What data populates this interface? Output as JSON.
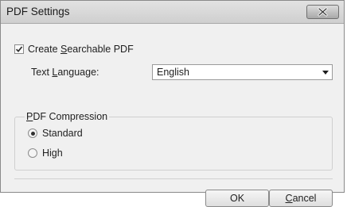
{
  "window": {
    "title": "PDF Settings"
  },
  "options": {
    "searchable": {
      "label_pre": "Create ",
      "label_ul": "S",
      "label_post": "earchable PDF",
      "checked": true
    },
    "language": {
      "label_pre": "Text ",
      "label_ul": "L",
      "label_post": "anguage:",
      "value": "English"
    }
  },
  "compression": {
    "group_ul": "P",
    "group_rest": "DF Compression",
    "options": [
      {
        "label": "Standard",
        "selected": true
      },
      {
        "label": "High",
        "selected": false
      }
    ]
  },
  "buttons": {
    "ok_label": "OK",
    "cancel_ul": "C",
    "cancel_rest": "ancel"
  },
  "icons": {
    "close": "close-icon",
    "check": "checkmark-icon",
    "dropdown": "chevron-down-icon"
  }
}
